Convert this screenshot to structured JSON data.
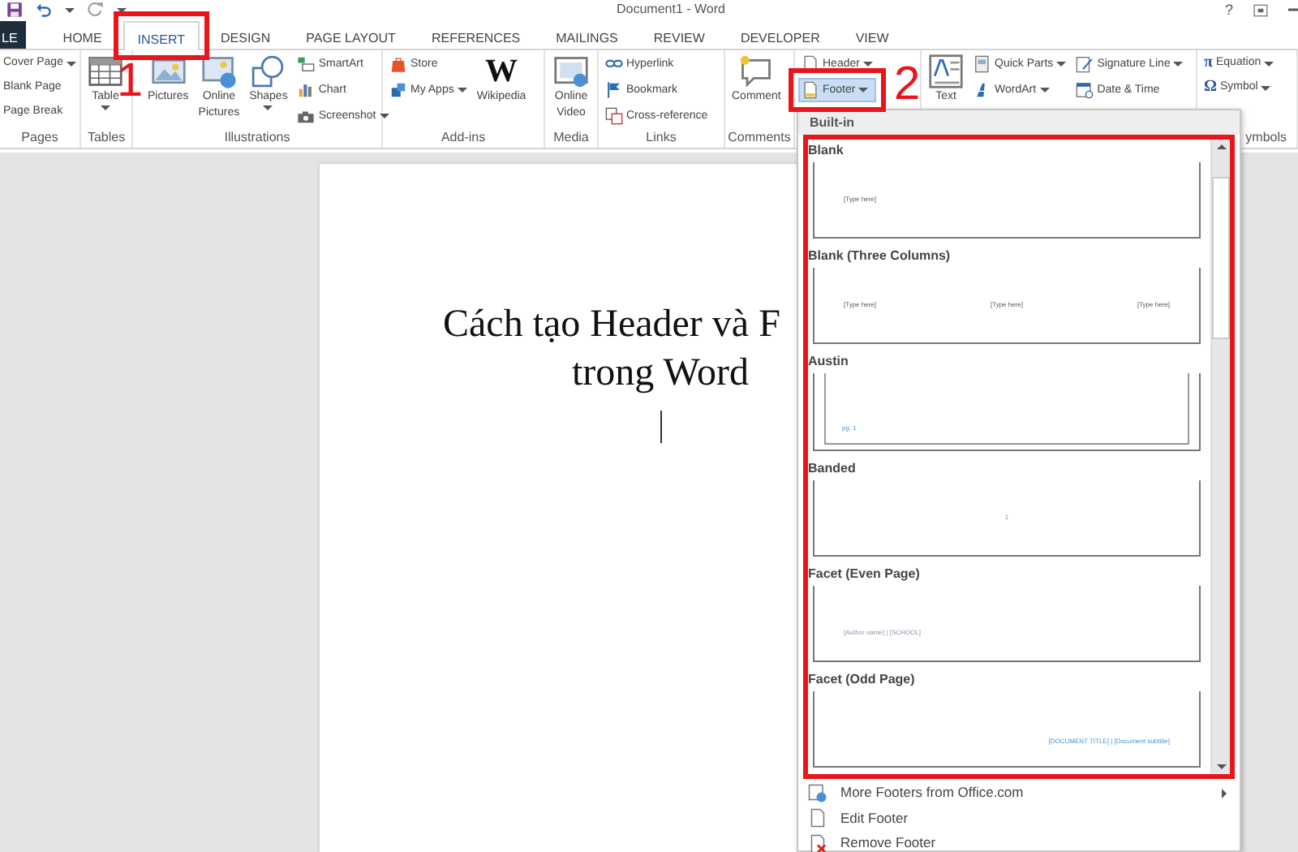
{
  "title_bar": {
    "title": "Document1 - Word",
    "help": "?"
  },
  "file_tab": {
    "label": "LE"
  },
  "tabs": [
    {
      "label": "HOME",
      "selected": false,
      "highlighted": false
    },
    {
      "label": "INSERT",
      "selected": true,
      "highlighted": true
    },
    {
      "label": "DESIGN",
      "selected": false,
      "highlighted": false
    },
    {
      "label": "PAGE LAYOUT",
      "selected": false,
      "highlighted": false
    },
    {
      "label": "REFERENCES",
      "selected": false,
      "highlighted": false
    },
    {
      "label": "MAILINGS",
      "selected": false,
      "highlighted": false
    },
    {
      "label": "REVIEW",
      "selected": false,
      "highlighted": false
    },
    {
      "label": "DEVELOPER",
      "selected": false,
      "highlighted": false
    },
    {
      "label": "VIEW",
      "selected": false,
      "highlighted": false
    }
  ],
  "ribbon": {
    "groups": [
      {
        "label": "Pages",
        "items": [
          {
            "kind": "stack",
            "items": [
              {
                "label": "Cover Page",
                "menu": true
              },
              {
                "label": "Blank Page",
                "menu": false
              },
              {
                "label": "Page Break",
                "menu": false
              }
            ]
          }
        ]
      },
      {
        "label": "Tables",
        "items": [
          {
            "kind": "large",
            "label": "Table",
            "menu": true
          }
        ]
      },
      {
        "label": "Illustrations",
        "items": [
          {
            "kind": "large",
            "label": "Pictures",
            "menu": false
          },
          {
            "kind": "large",
            "label": "Online Pictures",
            "menu": false
          },
          {
            "kind": "large",
            "label": "Shapes",
            "menu": true
          },
          {
            "kind": "stack",
            "items": [
              {
                "label": "SmartArt",
                "menu": false
              },
              {
                "label": "Chart",
                "menu": false
              },
              {
                "label": "Screenshot",
                "menu": true
              }
            ]
          }
        ]
      },
      {
        "label": "Add-ins",
        "items": [
          {
            "kind": "stack",
            "items": [
              {
                "label": "Store",
                "menu": false
              },
              {
                "label": "My Apps",
                "menu": true
              }
            ]
          },
          {
            "kind": "large",
            "label": "Wikipedia",
            "menu": false,
            "glyph": "W"
          }
        ]
      },
      {
        "label": "Media",
        "items": [
          {
            "kind": "large",
            "label": "Online Video",
            "menu": false
          }
        ]
      },
      {
        "label": "Links",
        "items": [
          {
            "kind": "stack",
            "items": [
              {
                "label": "Hyperlink",
                "menu": false
              },
              {
                "label": "Bookmark",
                "menu": false
              },
              {
                "label": "Cross-reference",
                "menu": false
              }
            ]
          }
        ]
      },
      {
        "label": "Comments",
        "items": [
          {
            "kind": "large",
            "label": "Comment",
            "menu": false
          }
        ]
      },
      {
        "items": [
          {
            "kind": "stack",
            "items": [
              {
                "label": "Header",
                "menu": true,
                "pressed": false,
                "highlighted": false
              },
              {
                "label": "Footer",
                "menu": true,
                "pressed": true,
                "highlighted": true
              }
            ]
          }
        ]
      },
      {
        "items": [
          {
            "kind": "large",
            "label": "Text",
            "menu": false
          },
          {
            "kind": "stack",
            "items": [
              {
                "label": "Quick Parts",
                "menu": true
              },
              {
                "label": "WordArt",
                "menu": true
              }
            ]
          },
          {
            "kind": "stack",
            "items": [
              {
                "label": "Signature Line",
                "menu": true
              },
              {
                "label": "Date & Time",
                "menu": false
              }
            ]
          }
        ]
      },
      {
        "label": "ymbols",
        "items": [
          {
            "kind": "stack",
            "items": [
              {
                "label": "Equation",
                "menu": true,
                "glyph": "π"
              },
              {
                "label": "Symbol",
                "menu": true,
                "glyph": "Ω"
              }
            ]
          }
        ]
      }
    ]
  },
  "document": {
    "heading": [
      "Cách tạo Header và F",
      "trong Word"
    ]
  },
  "footer_menu": {
    "section": "Built-in",
    "highlighted": true,
    "gallery": [
      {
        "name": "Blank",
        "kind": "left",
        "framed": false,
        "texts": [
          "[Type here]"
        ]
      },
      {
        "name": "Blank (Three Columns)",
        "kind": "columns",
        "framed": false,
        "texts": [
          "[Type here]",
          "[Type here]",
          "[Type here]"
        ]
      },
      {
        "name": "Austin",
        "kind": "left",
        "framed": true,
        "texts": [
          "pg. 1"
        ]
      },
      {
        "name": "Banded",
        "kind": "center",
        "framed": false,
        "texts": [
          "1"
        ]
      },
      {
        "name": "Facet (Even Page)",
        "kind": "left",
        "framed": false,
        "texts": [
          "[Author name] | [SCHOOL]"
        ]
      },
      {
        "name": "Facet (Odd Page)",
        "kind": "right",
        "framed": false,
        "texts": [
          "[DOCUMENT TITLE] | [Document subtitle]"
        ]
      }
    ],
    "commands": [
      {
        "label": "More Footers from Office.com",
        "submenu": true
      },
      {
        "label": "Edit Footer",
        "submenu": false
      },
      {
        "label": "Remove Footer",
        "submenu": false
      }
    ]
  },
  "annotations": [
    {
      "label": "1"
    },
    {
      "label": "2"
    }
  ]
}
